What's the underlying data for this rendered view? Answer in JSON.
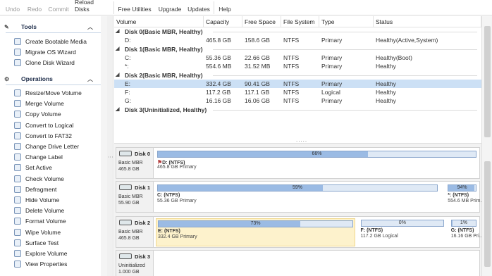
{
  "toolbar": {
    "undo": "Undo",
    "redo": "Redo",
    "commit": "Commit",
    "reload": "Reload Disks",
    "free_utilities": "Free Utilities",
    "upgrade": "Upgrade",
    "updates": "Updates",
    "help": "Help"
  },
  "sidebar": {
    "tools_title": "Tools",
    "tools": [
      {
        "label": "Create Bootable Media",
        "icon": "usb-icon"
      },
      {
        "label": "Migrate OS Wizard",
        "icon": "migrate-icon"
      },
      {
        "label": "Clone Disk Wizard",
        "icon": "clone-icon"
      }
    ],
    "operations_title": "Operations",
    "operations": [
      {
        "label": "Resize/Move Volume",
        "icon": "resize-icon"
      },
      {
        "label": "Merge Volume",
        "icon": "merge-icon"
      },
      {
        "label": "Copy Volume",
        "icon": "copy-icon"
      },
      {
        "label": "Convert to Logical",
        "icon": "convert-icon"
      },
      {
        "label": "Convert to FAT32",
        "icon": "convert-icon"
      },
      {
        "label": "Change Drive Letter",
        "icon": "letter-icon"
      },
      {
        "label": "Change Label",
        "icon": "label-icon"
      },
      {
        "label": "Set Active",
        "icon": "active-icon"
      },
      {
        "label": "Check Volume",
        "icon": "check-icon"
      },
      {
        "label": "Defragment",
        "icon": "defrag-icon"
      },
      {
        "label": "Hide Volume",
        "icon": "hide-icon"
      },
      {
        "label": "Delete Volume",
        "icon": "delete-icon"
      },
      {
        "label": "Format Volume",
        "icon": "format-icon"
      },
      {
        "label": "Wipe Volume",
        "icon": "wipe-icon"
      },
      {
        "label": "Surface Test",
        "icon": "surface-icon"
      },
      {
        "label": "Explore Volume",
        "icon": "explore-icon"
      },
      {
        "label": "View Properties",
        "icon": "properties-icon"
      }
    ]
  },
  "table": {
    "headers": [
      "Volume",
      "Capacity",
      "Free Space",
      "File System",
      "Type",
      "Status"
    ],
    "disks": [
      {
        "title": "Disk 0(Basic MBR, Healthy)",
        "rows": [
          {
            "volume": "D:",
            "capacity": "465.8 GB",
            "free": "158.6 GB",
            "fs": "NTFS",
            "type": "Primary",
            "status": "Healthy(Active,System)"
          }
        ]
      },
      {
        "title": "Disk 1(Basic MBR, Healthy)",
        "rows": [
          {
            "volume": "C:",
            "capacity": "55.36 GB",
            "free": "22.66 GB",
            "fs": "NTFS",
            "type": "Primary",
            "status": "Healthy(Boot)"
          },
          {
            "volume": "*:",
            "capacity": "554.6 MB",
            "free": "31.52 MB",
            "fs": "NTFS",
            "type": "Primary",
            "status": "Healthy"
          }
        ]
      },
      {
        "title": "Disk 2(Basic MBR, Healthy)",
        "rows": [
          {
            "volume": "E:",
            "capacity": "332.4 GB",
            "free": "90.41 GB",
            "fs": "NTFS",
            "type": "Primary",
            "status": "Healthy"
          },
          {
            "volume": "F:",
            "capacity": "117.2 GB",
            "free": "117.1 GB",
            "fs": "NTFS",
            "type": "Logical",
            "status": "Healthy"
          },
          {
            "volume": "G:",
            "capacity": "16.16 GB",
            "free": "16.06 GB",
            "fs": "NTFS",
            "type": "Primary",
            "status": "Healthy"
          }
        ]
      },
      {
        "title": "Disk 3(Uninitialized, Healthy)",
        "rows": []
      }
    ]
  },
  "diskmap": [
    {
      "name": "Disk 0",
      "line1": "Basic MBR",
      "line2": "465.8 GB",
      "partitions": [
        {
          "pct_label": "66%",
          "used": 0.66,
          "name": "D: (NTFS)",
          "desc": "465.8 GB Primary",
          "flag": "⚑"
        }
      ]
    },
    {
      "name": "Disk 1",
      "line1": "Basic MBR",
      "line2": "55.90 GB",
      "partitions": [
        {
          "pct_label": "59%",
          "used": 0.59,
          "name": "C: (NTFS)",
          "desc": "55.36 GB Primary"
        },
        {
          "pct_label": "94%",
          "used": 0.94,
          "name": "*: (NTFS)",
          "desc": "554.6 MB Prim..."
        }
      ]
    },
    {
      "name": "Disk 2",
      "line1": "Basic MBR",
      "line2": "465.8 GB",
      "partitions": [
        {
          "pct_label": "73%",
          "used": 0.73,
          "name": "E: (NTFS)",
          "desc": "332.4 GB Primary"
        },
        {
          "pct_label": "0%",
          "used": 0.0,
          "name": "F: (NTFS)",
          "desc": "117.2 GB Logical"
        },
        {
          "pct_label": "1%",
          "used": 0.01,
          "name": "G: (NTFS)",
          "desc": "16.16 GB Pri..."
        }
      ]
    },
    {
      "name": "Disk 3",
      "line1": "Uninitialized",
      "line2": "1.000 GB",
      "partitions": []
    }
  ],
  "more_dots": "....."
}
